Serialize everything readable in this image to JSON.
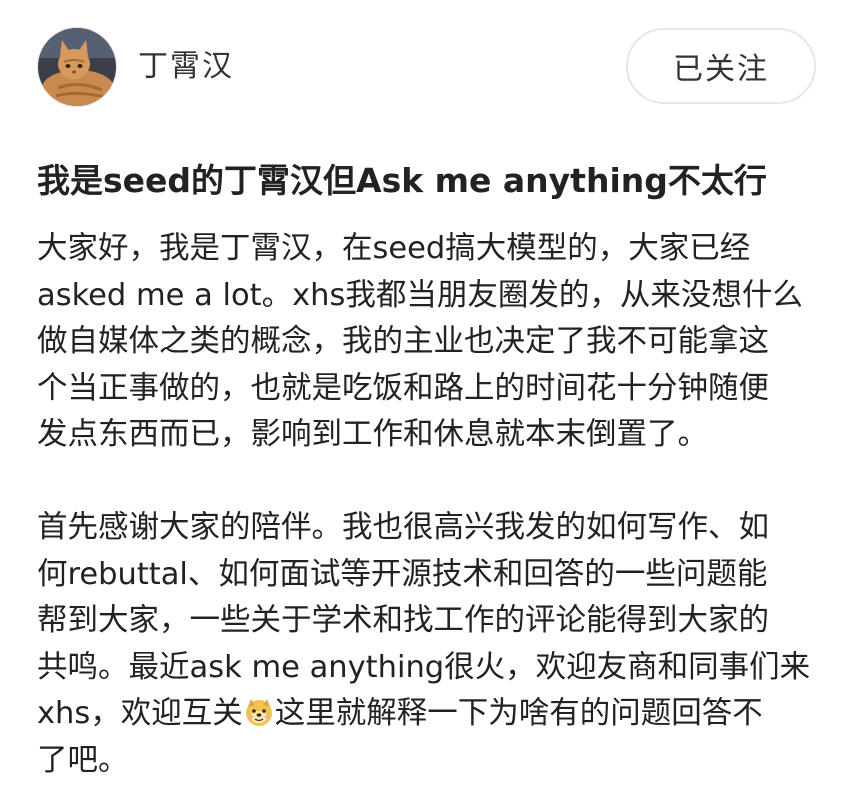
{
  "author": {
    "name": "丁霄汉",
    "avatar_icon": "cat-avatar-icon"
  },
  "follow_button": {
    "label": "已关注"
  },
  "post": {
    "title": "我是seed的丁霄汉但Ask me anything不太行",
    "paragraph1": [
      "大家好，我是丁霄汉，在seed搞大模型的，大家已经",
      "asked me a lot。xhs我都当朋友圈发的，从来没想什么",
      "做自媒体之类的概念，我的主业也决定了我不可能拿这",
      "个当正事做的，也就是吃饭和路上的时间花十分钟随便",
      "发点东西而已，影响到工作和休息就本末倒置了。"
    ],
    "paragraph2": [
      "首先感谢大家的陪伴。我也很高兴我发的如何写作、如",
      "何rebuttal、如何面试等开源技术和回答的一些问题能",
      "帮到大家，一些关于学术和找工作的评论能得到大家的",
      "共鸣。最近ask me anything很火，欢迎友商和同事们来"
    ],
    "line10_before_emoji": "xhs，欢迎互关",
    "emoji_icon": "doge-emoji-icon",
    "line10_after_emoji": "这里就解释一下为啥有的问题回答不",
    "line11": "了吧。"
  }
}
